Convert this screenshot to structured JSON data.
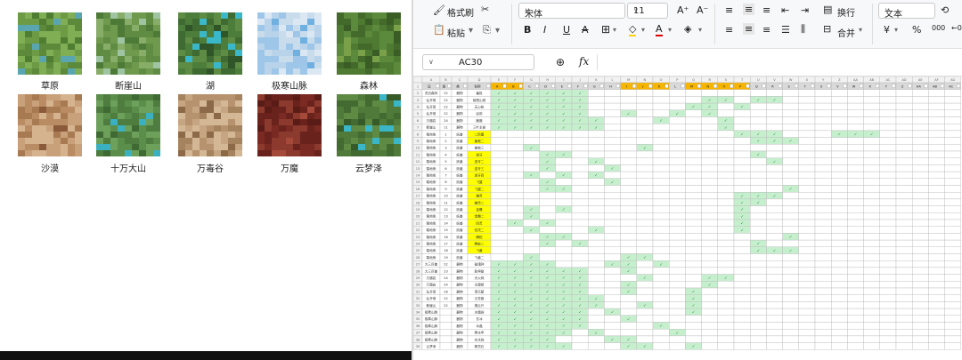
{
  "file_browser": {
    "items": [
      {
        "label": "草原",
        "palette": [
          "#6c9a45",
          "#5c8a3a",
          "#7fae55",
          "#4f7d32"
        ],
        "accent": "#5aa6b0"
      },
      {
        "label": "断崖山",
        "palette": [
          "#6f9a4e",
          "#5f8c42",
          "#88ad68",
          "#4d7a37"
        ],
        "accent": "#9fc4a2"
      },
      {
        "label": "湖",
        "palette": [
          "#4d7d3a",
          "#3f6a31",
          "#5f8c44",
          "#2f5528"
        ],
        "accent": "#3ab7c8"
      },
      {
        "label": "极寒山脉",
        "palette": [
          "#c9dcec",
          "#b8d3ea",
          "#9ec6e8",
          "#dbe8f3"
        ],
        "accent": "#6fb0e0"
      },
      {
        "label": "森林",
        "palette": [
          "#4f7a32",
          "#43692b",
          "#5c8a3c",
          "#3a5c25"
        ],
        "accent": "#7aa04a"
      },
      {
        "label": "沙漠",
        "palette": [
          "#c8a07a",
          "#b98c63",
          "#d6b38f",
          "#a87a52"
        ],
        "accent": "#8a5a3a"
      },
      {
        "label": "十万大山",
        "palette": [
          "#5b8e4a",
          "#4e7d3f",
          "#6da05a",
          "#3f6a33"
        ],
        "accent": "#3ab0c0"
      },
      {
        "label": "万毒谷",
        "palette": [
          "#c6a582",
          "#b6936e",
          "#d4b896",
          "#a6835f"
        ],
        "accent": "#8c6a48"
      },
      {
        "label": "万魔",
        "palette": [
          "#7a2a22",
          "#6a221c",
          "#8c3a2e",
          "#5a1c16"
        ],
        "accent": "#a54a3a"
      },
      {
        "label": "云梦泽",
        "palette": [
          "#4f7a3a",
          "#426a31",
          "#5e8a44",
          "#365a28"
        ],
        "accent": "#3ab6c6"
      }
    ]
  },
  "ribbon": {
    "format_painter": "格式刷",
    "paste": "粘贴",
    "font_name": "宋体",
    "font_size": "11",
    "wrap": "换行",
    "merge": "合并",
    "number_format": "文本",
    "percent": "%",
    "thousands": "000",
    "decimals": "←0"
  },
  "formula_bar": {
    "cell_ref": "AC30",
    "fx": "fx",
    "formula": ""
  },
  "spreadsheet": {
    "columns": [
      "A",
      "B",
      "C",
      "D",
      "E",
      "F",
      "G",
      "H",
      "I",
      "J",
      "K",
      "L",
      "M",
      "N",
      "O",
      "P",
      "Q",
      "R",
      "S",
      "T",
      "U",
      "V",
      "W",
      "X",
      "Y",
      "Z",
      "AA",
      "AB",
      "AC",
      "AD",
      "AE",
      "AF",
      "AG"
    ],
    "header_row": [
      "区",
      "层",
      "类",
      "名称",
      "A",
      "B",
      "C",
      "D",
      "E",
      "F",
      "G",
      "H",
      "I",
      "J",
      "K",
      "L",
      "M",
      "N",
      "O",
      "P",
      "Q",
      "R",
      "S",
      "T",
      "U",
      "V",
      "W",
      "X",
      "Y",
      "Z",
      "AA",
      "AB",
      "AC"
    ],
    "header_highlight_cols": [
      4,
      5,
      12,
      13,
      14,
      16,
      17,
      18,
      19
    ],
    "check_mark": "✓",
    "rows": [
      {
        "a": "灵泊森林",
        "b": "22",
        "c": "器物",
        "d": "番投",
        "hl": false,
        "checks": [
          4,
          5,
          6,
          7,
          8,
          9
        ]
      },
      {
        "a": "弘开塔",
        "b": "22",
        "c": "器物",
        "d": "破镜山塔",
        "hl": false,
        "checks": [
          4,
          5,
          6,
          7,
          8,
          9,
          17,
          18,
          20,
          21
        ]
      },
      {
        "a": "弘开塔",
        "b": "22",
        "c": "器物",
        "d": "无心帐",
        "hl": false,
        "checks": [
          4,
          5,
          6,
          7,
          8,
          9,
          16,
          17,
          19
        ]
      },
      {
        "a": "弘开塔",
        "b": "22",
        "c": "器物",
        "d": "谷前",
        "hl": false,
        "checks": [
          4,
          5,
          6,
          7,
          8,
          9,
          12,
          15,
          17
        ]
      },
      {
        "a": "万魔岩",
        "b": "24",
        "c": "器物",
        "d": "器魔",
        "hl": false,
        "checks": [
          4,
          5,
          6,
          7,
          8,
          9,
          10,
          14,
          18
        ]
      },
      {
        "a": "断崖山",
        "b": "11",
        "c": "器物",
        "d": "三叶羊部",
        "hl": false,
        "checks": [
          4,
          5,
          6,
          7,
          8,
          9,
          10,
          18
        ]
      },
      {
        "a": "裂地熊",
        "b": "1",
        "c": "妖兽",
        "d": "二阶壹",
        "hl": true,
        "checks": [
          19,
          20,
          21,
          25,
          26,
          27
        ]
      },
      {
        "a": "裂地熊",
        "b": "2",
        "c": "妖兽",
        "d": "兽蛟二",
        "hl": true,
        "checks": [
          20,
          21,
          22
        ]
      },
      {
        "a": "裂地熊",
        "b": "3",
        "c": "妖兽",
        "d": "兽蛟三",
        "hl": false,
        "checks": [
          6,
          13
        ]
      },
      {
        "a": "裂地熊",
        "b": "4",
        "c": "妖兽",
        "d": "逆牙",
        "hl": true,
        "checks": [
          7,
          8,
          20
        ]
      },
      {
        "a": "裂地熊",
        "b": "5",
        "c": "妖兽",
        "d": "逆牙二",
        "hl": true,
        "checks": [
          7,
          10,
          21
        ]
      },
      {
        "a": "裂地熊",
        "b": "6",
        "c": "妖兽",
        "d": "逆牙三",
        "hl": true,
        "checks": [
          7,
          11
        ]
      },
      {
        "a": "裂地熊",
        "b": "7",
        "c": "妖兽",
        "d": "逆牙四",
        "hl": true,
        "checks": [
          6,
          8,
          10
        ]
      },
      {
        "a": "裂地熊",
        "b": "8",
        "c": "妖兽",
        "d": "飞翼",
        "hl": true,
        "checks": [
          7,
          11
        ]
      },
      {
        "a": "裂地熊",
        "b": "9",
        "c": "妖兽",
        "d": "飞翼二",
        "hl": true,
        "checks": [
          7,
          8,
          22
        ]
      },
      {
        "a": "裂地熊",
        "b": "10",
        "c": "妖兽",
        "d": "赚灵",
        "hl": true,
        "checks": [
          19,
          20,
          21
        ]
      },
      {
        "a": "裂地熊",
        "b": "11",
        "c": "妖兽",
        "d": "赚灵二",
        "hl": true,
        "checks": [
          19,
          20
        ]
      },
      {
        "a": "裂地熊",
        "b": "12",
        "c": "妖兽",
        "d": "金雕",
        "hl": true,
        "checks": [
          6,
          8,
          19
        ]
      },
      {
        "a": "裂地熊",
        "b": "13",
        "c": "妖兽",
        "d": "金雕二",
        "hl": true,
        "checks": [
          6,
          19
        ]
      },
      {
        "a": "裂地熊",
        "b": "14",
        "c": "妖兽",
        "d": "四灵",
        "hl": true,
        "checks": [
          5,
          7,
          19
        ]
      },
      {
        "a": "裂地熊",
        "b": "15",
        "c": "妖兽",
        "d": "四灵二",
        "hl": true,
        "checks": [
          6,
          10,
          19
        ]
      },
      {
        "a": "裂地熊",
        "b": "16",
        "c": "妖兽",
        "d": "腾蛇",
        "hl": true,
        "checks": [
          7,
          8,
          22
        ]
      },
      {
        "a": "裂地熊",
        "b": "17",
        "c": "妖兽",
        "d": "腾蛇二",
        "hl": true,
        "checks": [
          7,
          9,
          20
        ]
      },
      {
        "a": "裂地熊",
        "b": "18",
        "c": "妖兽",
        "d": "飞兽",
        "hl": true,
        "checks": [
          20,
          21,
          22
        ]
      },
      {
        "a": "裂地熊",
        "b": "19",
        "c": "妖兽",
        "d": "飞兽二",
        "hl": false,
        "checks": [
          6,
          12,
          13
        ]
      },
      {
        "a": "大三巨兽",
        "b": "22",
        "c": "器物",
        "d": "破魂钟",
        "hl": false,
        "checks": [
          4,
          5,
          6,
          7,
          11,
          12,
          14
        ]
      },
      {
        "a": "大三巨兽",
        "b": "23",
        "c": "器物",
        "d": "乾坤鼎",
        "hl": false,
        "checks": [
          4,
          5,
          6,
          7,
          8,
          9,
          12
        ]
      },
      {
        "a": "万魔岩",
        "b": "24",
        "c": "器物",
        "d": "天火珠",
        "hl": false,
        "checks": [
          4,
          5,
          6,
          7,
          8,
          9,
          13,
          17,
          18
        ]
      },
      {
        "a": "万魔岩",
        "b": "24",
        "c": "器物",
        "d": "天魔镜",
        "hl": false,
        "checks": [
          4,
          5,
          6,
          7,
          8,
          9,
          12,
          17
        ]
      },
      {
        "a": "弘开塔",
        "b": "26",
        "c": "器物",
        "d": "混元壁",
        "hl": false,
        "checks": [
          4,
          5,
          6,
          7,
          8,
          9,
          12,
          16
        ]
      },
      {
        "a": "弘开塔",
        "b": "22",
        "c": "器物",
        "d": "五芳旗",
        "hl": false,
        "checks": [
          4,
          5,
          6,
          7,
          8,
          9,
          10,
          16
        ]
      },
      {
        "a": "断崖山",
        "b": "22",
        "c": "器物",
        "d": "拂云尺",
        "hl": false,
        "checks": [
          4,
          5,
          6,
          7,
          8,
          9,
          10,
          13,
          16
        ]
      },
      {
        "a": "极寒山脉",
        "b": "",
        "c": "器物",
        "d": "冰霜珠",
        "hl": false,
        "checks": [
          4,
          5,
          6,
          7,
          8,
          9,
          11,
          16
        ]
      },
      {
        "a": "极寒山脉",
        "b": "",
        "c": "器物",
        "d": "玄冰",
        "hl": false,
        "checks": [
          4,
          5,
          6,
          7,
          8,
          9,
          12
        ]
      },
      {
        "a": "极寒山脉",
        "b": "",
        "c": "器物",
        "d": "冰晶",
        "hl": false,
        "checks": [
          4,
          5,
          6,
          7,
          8,
          9,
          14
        ]
      },
      {
        "a": "极寒山脉",
        "b": "",
        "c": "器物",
        "d": "寒冰甲",
        "hl": false,
        "checks": [
          4,
          5,
          6,
          7,
          8,
          10,
          15
        ]
      },
      {
        "a": "极寒山脉",
        "b": "",
        "c": "器物",
        "d": "玄冰珠",
        "hl": false,
        "checks": [
          4,
          5,
          6,
          7,
          11,
          12
        ]
      },
      {
        "a": "云梦泽",
        "b": "",
        "c": "器物",
        "d": "雾灵石",
        "hl": false,
        "checks": [
          4,
          5,
          6,
          7,
          8,
          12,
          13,
          16
        ]
      }
    ]
  },
  "colors": {
    "check_bg": "#c6efce",
    "yellow": "#ffff00",
    "header_orange": "#f7b500",
    "header_gray": "#d9d9d9"
  }
}
